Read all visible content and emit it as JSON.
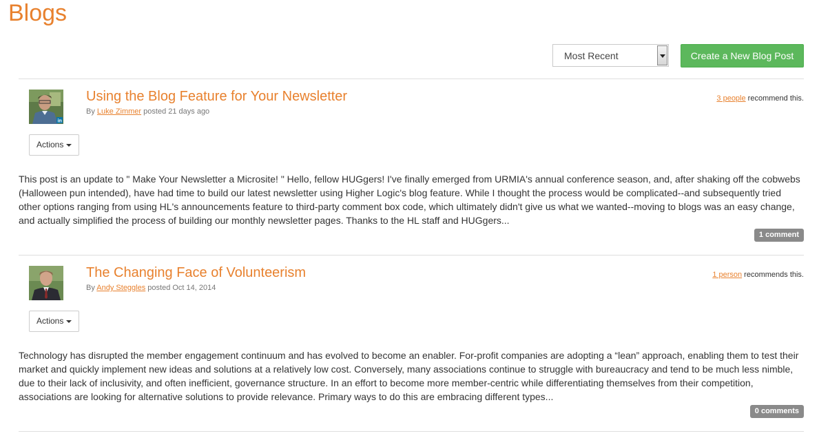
{
  "page": {
    "title": "Blogs"
  },
  "toolbar": {
    "sort_value": "Most Recent",
    "create_label": "Create a New Blog Post"
  },
  "colors": {
    "accent": "#e8812e",
    "create_button": "#5cb85c",
    "badge": "#8a8a8a"
  },
  "posts": [
    {
      "title": "Using the Blog Feature for Your Newsletter",
      "by": "By",
      "author": "Luke Zimmer",
      "posted": "posted 21 days ago",
      "recommend_link": "3 people",
      "recommend_text": " recommend this.",
      "actions_label": "Actions",
      "excerpt": "This post is an update to \" Make Your Newsletter a Microsite! \" Hello, fellow HUGgers! I've finally emerged from URMIA's annual conference season, and, after shaking off the cobwebs (Halloween pun intended), have had time to build our latest newsletter using Higher Logic's blog feature. While I thought the process would be complicated--and subsequently tried other options ranging from using HL's announcements feature to third-party comment box code, which ultimately didn't give us what we wanted--moving to blogs was an easy change, and actually simplified the process of building our monthly newsletter pages. Thanks to the HL staff and HUGgers...",
      "comments": "1 comment"
    },
    {
      "title": "The Changing Face of Volunteerism",
      "by": "By",
      "author": "Andy Steggles",
      "posted": "posted Oct 14, 2014",
      "recommend_link": "1 person",
      "recommend_text": " recommends this.",
      "actions_label": "Actions",
      "excerpt": "Technology has disrupted the member engagement continuum and has evolved to become an enabler. For-profit companies are adopting a “lean” approach, enabling them to test their market and quickly implement new ideas and solutions at a relatively low cost. Conversely, many associations continue to struggle with bureaucracy and tend to be much less nimble, due to their lack of inclusivity, and often inefficient, governance structure. In an effort to become more member-centric while differentiating themselves from their competition, associations are looking for alternative solutions to provide relevance. Primary ways to do this are embracing different types...",
      "comments": "0 comments"
    }
  ]
}
